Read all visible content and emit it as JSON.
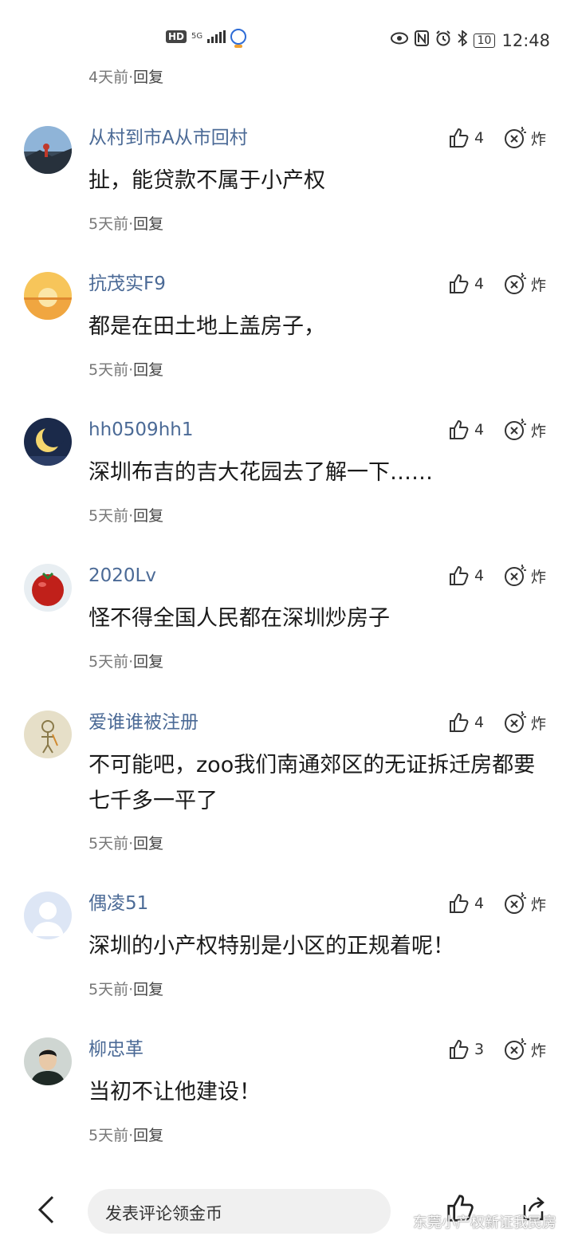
{
  "status_bar": {
    "hd": "HD",
    "network": "5G",
    "battery": "10",
    "time": "12:48"
  },
  "top_meta": {
    "time": "4天前",
    "reply": "回复"
  },
  "comments": [
    {
      "name": "从村到市A从市回村",
      "text": "扯，能贷款不属于小产权",
      "likes": "4",
      "bomb": "炸",
      "time": "5天前",
      "reply": "回复"
    },
    {
      "name": "抗茂实F9",
      "text": "都是在田土地上盖房子，",
      "likes": "4",
      "bomb": "炸",
      "time": "5天前",
      "reply": "回复"
    },
    {
      "name": "hh0509hh1",
      "text": "深圳布吉的吉大花园去了解一下……",
      "likes": "4",
      "bomb": "炸",
      "time": "5天前",
      "reply": "回复"
    },
    {
      "name": "2020Lv",
      "text": "怪不得全国人民都在深圳炒房子",
      "likes": "4",
      "bomb": "炸",
      "time": "5天前",
      "reply": "回复"
    },
    {
      "name": "爱谁谁被注册",
      "text": "不可能吧，zoo我们南通郊区的无证拆迁房都要七千多一平了",
      "likes": "4",
      "bomb": "炸",
      "time": "5天前",
      "reply": "回复"
    },
    {
      "name": "偶凌51",
      "text": "深圳的小产权特别是小区的正规着呢！",
      "likes": "4",
      "bomb": "炸",
      "time": "5天前",
      "reply": "回复"
    },
    {
      "name": "柳忠革",
      "text": "当初不让他建设！",
      "likes": "3",
      "bomb": "炸",
      "time": "5天前",
      "reply": "回复"
    }
  ],
  "bottom_bar": {
    "input_placeholder": "发表评论领金币",
    "watermark": "东莞小产权新证我民房"
  },
  "colors": {
    "name": "#4b6a96",
    "text": "#1a1a1a",
    "meta": "#777777"
  }
}
